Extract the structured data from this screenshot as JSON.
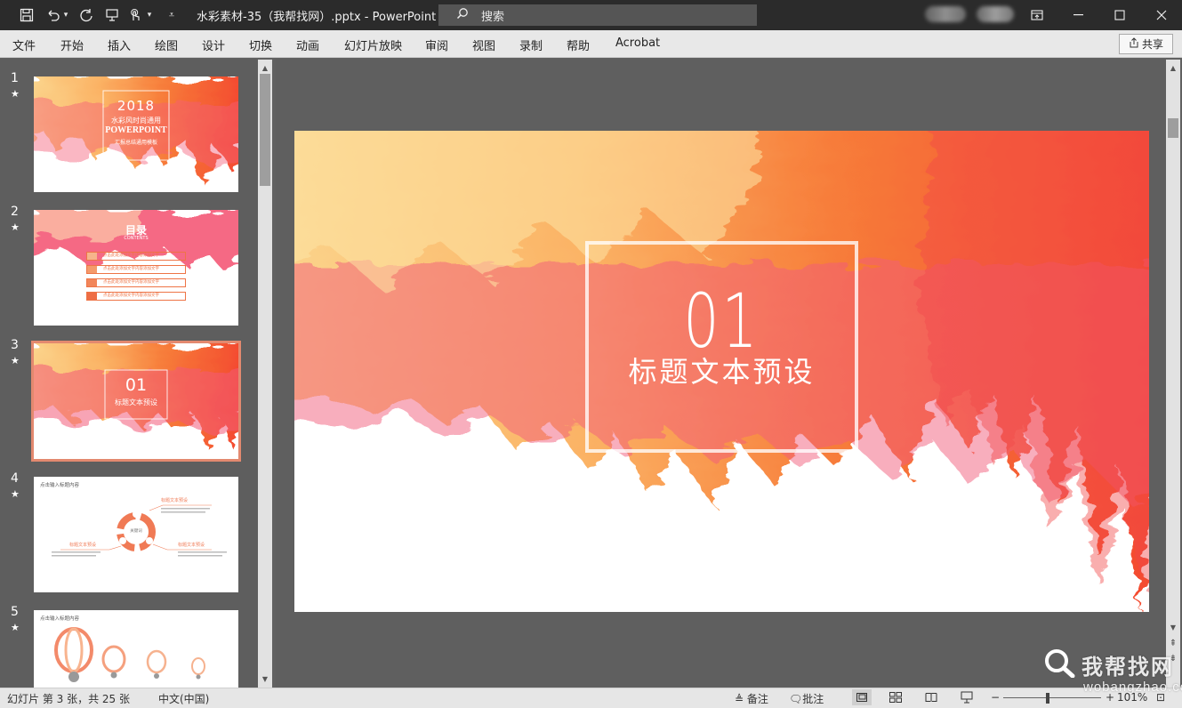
{
  "app": {
    "title": "水彩素材-35（我帮找网）.pptx  -  PowerPoint",
    "search_label": "搜索"
  },
  "ribbon": {
    "tabs": [
      "文件",
      "开始",
      "插入",
      "绘图",
      "设计",
      "切换",
      "动画",
      "幻灯片放映",
      "审阅",
      "视图",
      "录制",
      "帮助",
      "Acrobat"
    ],
    "share_label": "共享"
  },
  "slides": [
    {
      "num": "1",
      "star": "★",
      "texts": [
        "2018",
        "水彩风时尚通用",
        "POWERPOINT",
        "汇报总结通用模板"
      ]
    },
    {
      "num": "2",
      "star": "★",
      "texts": [
        "目录",
        "CONTENTS",
        "点击此处添加文字内容添加文字",
        "点击此处添加文字内容添加文字",
        "点击此处添加文字内容添加文字",
        "点击此处添加文字内容添加文字"
      ]
    },
    {
      "num": "3",
      "star": "★",
      "texts": [
        "01",
        "标题文本预设"
      ]
    },
    {
      "num": "4",
      "star": "★",
      "texts": [
        "点击输入标题内容",
        "标题文本预设",
        "关键词",
        "标题文本预设",
        "标题文本预设"
      ]
    },
    {
      "num": "5",
      "star": "★",
      "texts": [
        "点击输入标题内容"
      ]
    }
  ],
  "current_slide": {
    "number": "01",
    "title": "标题文本预设"
  },
  "statusbar": {
    "slide_info": "幻灯片 第 3 张，共 25 张",
    "language": "中文(中国)",
    "notes_label": "备注",
    "comments_label": "批注",
    "zoom": "101%"
  },
  "watermark": {
    "text": "我帮找网",
    "url": "wobangzhao.com"
  },
  "colors": {
    "accent": "#e3896f",
    "titlebar": "#2b2b2b",
    "ribbon": "#e8e8e8"
  }
}
